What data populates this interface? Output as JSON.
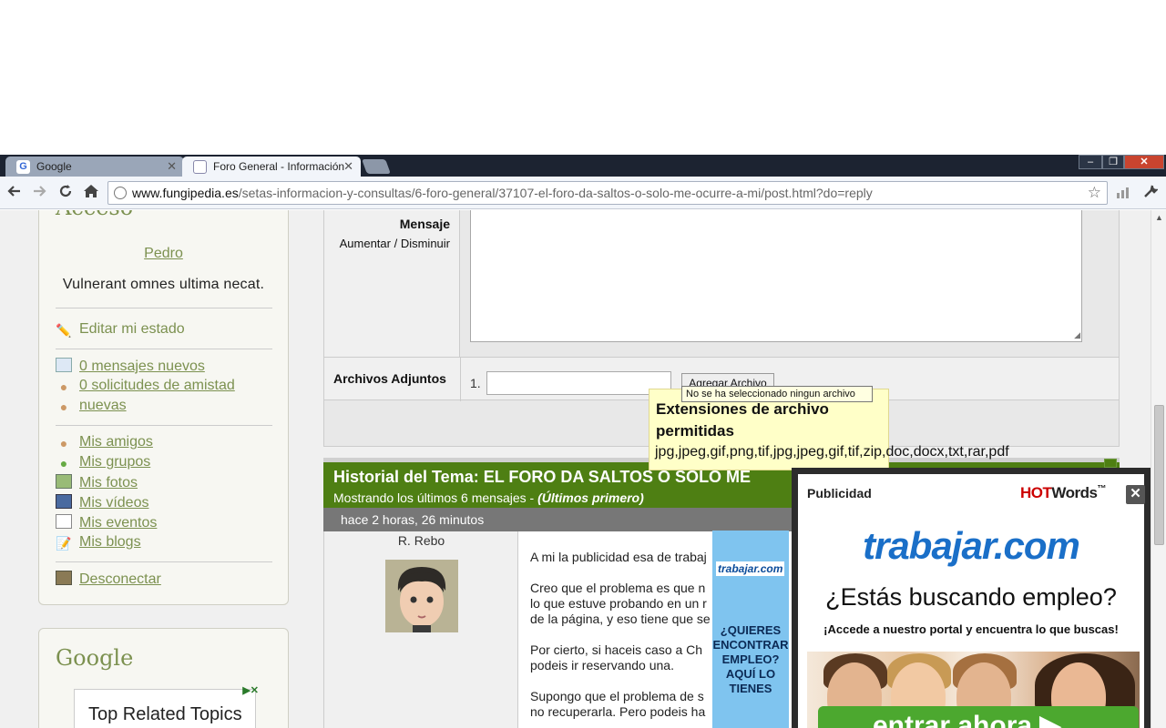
{
  "browser": {
    "tabs": [
      {
        "title": "Google",
        "favicon": "G",
        "active": false
      },
      {
        "title": "Foro General - Información",
        "active": true
      }
    ],
    "url_host": "www.fungipedia.es",
    "url_path": "/setas-informacion-y-consultas/6-foro-general/37107-el-foro-da-saltos-o-solo-me-ocurre-a-mi/post.html?do=reply",
    "window_buttons": {
      "minimize": "–",
      "maximize": "❐",
      "close": "✕"
    },
    "icons": {
      "back": "back-arrow-icon",
      "forward": "forward-arrow-icon",
      "reload": "reload-icon",
      "home": "home-icon",
      "star": "star-icon",
      "wrench": "wrench-icon"
    }
  },
  "sidebar": {
    "access_title": "Acceso",
    "user_name": "Pedro",
    "user_status": "Vulnerant omnes ultima necat.",
    "edit_status": "Editar mi estado",
    "notifications": [
      "0 mensajes nuevos",
      "0 solicitudes de amistad",
      "nuevas"
    ],
    "links": [
      "Mis amigos",
      "Mis grupos",
      "Mis fotos",
      "Mis vídeos",
      "Mis eventos",
      "Mis blogs"
    ],
    "logout": "Desconectar",
    "google_title": "Google",
    "topics_title": "Top Related Topics"
  },
  "form": {
    "message_label": "Mensaje",
    "resize_increase": "Aumentar /",
    "resize_decrease": "Disminuir",
    "attachments_label": "Archivos Adjuntos",
    "attachment_number": "1.",
    "add_file_button": "Agregar Archivo",
    "no_file_tooltip": "No se ha seleccionado ningun archivo",
    "extensions_title": "Extensiones de archivo permitidas",
    "extensions_list": "jpg,jpeg,gif,png,tif,jpg,jpeg,gif,tif,zip,doc,docx,txt,rar,pdf"
  },
  "history": {
    "title": "Historial del Tema: EL FORO DA SALTOS O SOLO ME",
    "subtitle_prefix": "Mostrando los últimos 6 mensajes - ",
    "subtitle_order": "(Últimos primero)",
    "post_time": "hace 2 horas, 26 minutos",
    "post_author": "R. Rebo",
    "post_lines": [
      [
        "A mi la publicidad esa de trabaj"
      ],
      [
        "Creo que el problema es que n",
        "lo que estuve probando en un r",
        "de la página, y eso tiene que se"
      ],
      [
        "Por cierto, si haceis caso a Ch",
        "podeis ir reservando una."
      ],
      [
        "Supongo que el problema de s",
        "no recuperarla. Pero podeis ha"
      ]
    ]
  },
  "ads": {
    "side_logo": "trabajar.com",
    "side_text": "¿QUIERES ENCONTRAR EMPLEO? AQUÍ LO TIENES",
    "panel_label": "Publicidad",
    "brand_hot": "HOT",
    "brand_words": "Words",
    "brand_mark": "™",
    "close": "✕",
    "logo": "trabajar.com",
    "headline": "¿Estás buscando empleo?",
    "subheadline": "¡Accede a nuestro portal y encuentra lo que buscas!",
    "cta": "entrar ahora ▶"
  }
}
